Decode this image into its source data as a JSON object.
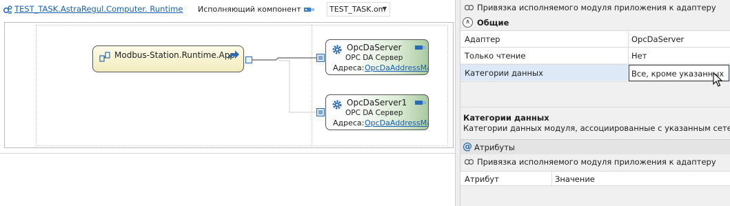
{
  "toolbar": {
    "project_link": "TEST_TASK.AstraRegul.Computer. Runtime",
    "component_label": "Исполняющий компонент",
    "component_value": "TEST_TASK.om"
  },
  "diagram": {
    "app_node": {
      "label": "Modbus-Station.Runtime.App",
      "icon": "app-icon"
    },
    "servers": [
      {
        "title": "OpcDaServer",
        "subtitle": "OPC DA Сервер",
        "address_label": "Адреса:",
        "address_link": "OpcDaAddressMap"
      },
      {
        "title": "OpcDaServer1",
        "subtitle": "OPC DA Сервер",
        "address_label": "Адреса:",
        "address_link": "OpcDaAddressMap"
      }
    ]
  },
  "properties": {
    "binding_title": "Привязка исполняемого модуля приложения к адаптеру",
    "category": "Общие",
    "rows": [
      {
        "name": "Адаптер",
        "value": "OpcDaServer"
      },
      {
        "name": "Только чтение",
        "value": "Нет"
      },
      {
        "name": "Категории данных",
        "value": "Все, кроме указанных"
      }
    ],
    "description": {
      "title": "Категории данных",
      "text": "Категории данных модуля, ассоциированные с указанным сетевым адаптером"
    }
  },
  "attributes": {
    "title": "Атрибуты",
    "binding_title": "Привязка исполняемого модуля приложения к адаптеру",
    "columns": [
      "Атрибут",
      "Значение"
    ]
  },
  "colors": {
    "link": "#1a5fb4",
    "selected_row": "#dde9f7",
    "server_gradient_end": "#a9cba0",
    "app_node_fill": "#f2ecbd"
  }
}
